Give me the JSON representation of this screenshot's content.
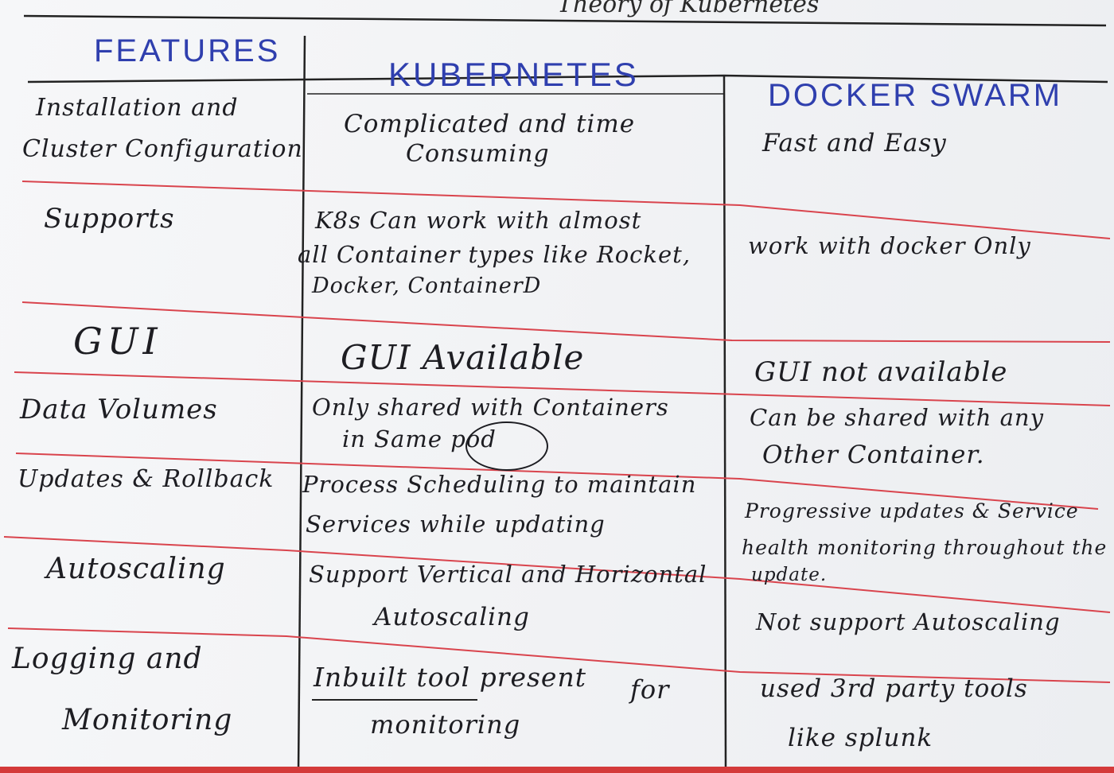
{
  "title_fragment": "Theory of Kubernetes",
  "headers": {
    "features": "FEATURES",
    "kubernetes": "KUBERNETES",
    "docker_swarm": "DOCKER SWARM"
  },
  "rows": [
    {
      "feature": [
        "Installation and",
        "Cluster Configuration"
      ],
      "kubernetes": [
        "Complicated and time",
        "Consuming"
      ],
      "docker_swarm": [
        "Fast and Easy"
      ]
    },
    {
      "feature": [
        "Supports"
      ],
      "kubernetes": [
        "K8s Can work with almost",
        "all Container types like Rocket,",
        "Docker, ContainerD"
      ],
      "docker_swarm": [
        "work with docker Only"
      ]
    },
    {
      "feature": [
        "GUI"
      ],
      "kubernetes": [
        "GUI Available"
      ],
      "docker_swarm": [
        "GUI not available"
      ]
    },
    {
      "feature": [
        "Data Volumes"
      ],
      "kubernetes": [
        "Only shared with Containers",
        "in Same pod"
      ],
      "docker_swarm": [
        "Can be shared with any",
        "Other Container."
      ]
    },
    {
      "feature": [
        "Updates & Rollback"
      ],
      "kubernetes": [
        "Process Scheduling to maintain",
        "Services while updating"
      ],
      "docker_swarm": [
        "Progressive updates & Service",
        "health monitoring throughout the",
        "update."
      ]
    },
    {
      "feature": [
        "Autoscaling"
      ],
      "kubernetes": [
        "Support Vertical and Horizontal",
        "Autoscaling"
      ],
      "docker_swarm": [
        "Not support Autoscaling"
      ]
    },
    {
      "feature": [
        "Logging and",
        "Monitoring"
      ],
      "kubernetes": [
        "Inbuilt tool present",
        "monitoring",
        "for"
      ],
      "docker_swarm": [
        "used 3rd party tools",
        "like splunk"
      ]
    }
  ]
}
